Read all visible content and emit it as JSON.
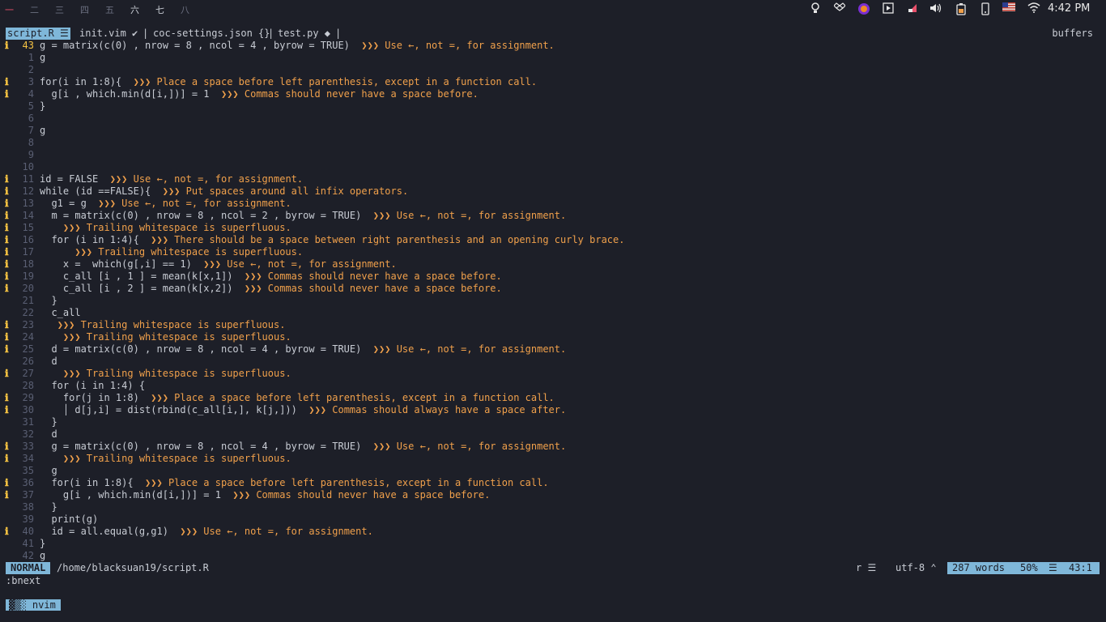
{
  "workspaces": [
    "一",
    "二",
    "三",
    "四",
    "五",
    "六",
    "七",
    "八"
  ],
  "clock": "4:42 PM",
  "tray_icons": [
    "bulb-icon",
    "dropbox-icon",
    "firefox-icon",
    "media-play-icon",
    "app-icon",
    "volume-icon",
    "battery-icon",
    "phone-icon",
    "us-flag-icon",
    "wifi-icon"
  ],
  "tabs": {
    "active": "script.R ☰",
    "others": [
      "init.vim ✔",
      "|",
      "coc-settings.json {}",
      "|",
      "test.py ◆",
      "|"
    ],
    "buffers_label": "buffers"
  },
  "lines": [
    {
      "sign": "ℹ",
      "num": "43",
      "cur": true,
      "code": "g = matrix(c(0) , nrow = 8 , ncol = 4 , byrow = TRUE)",
      "msg": "  ❯❯❯ Use ←, not =, for assignment."
    },
    {
      "sign": "",
      "num": "1",
      "code": "g",
      "msg": ""
    },
    {
      "sign": "",
      "num": "2",
      "code": "",
      "msg": ""
    },
    {
      "sign": "ℹ",
      "num": "3",
      "code": "for(i in 1:8){",
      "msg": "  ❯❯❯ Place a space before left parenthesis, except in a function call."
    },
    {
      "sign": "ℹ",
      "num": "4",
      "code": "  g[i , which.min(d[i,])] = 1",
      "msg": "  ❯❯❯ Commas should never have a space before."
    },
    {
      "sign": "",
      "num": "5",
      "code": "}",
      "msg": ""
    },
    {
      "sign": "",
      "num": "6",
      "code": "",
      "msg": ""
    },
    {
      "sign": "",
      "num": "7",
      "code": "g",
      "msg": ""
    },
    {
      "sign": "",
      "num": "8",
      "code": "",
      "msg": ""
    },
    {
      "sign": "",
      "num": "9",
      "code": "",
      "msg": ""
    },
    {
      "sign": "",
      "num": "10",
      "code": "",
      "msg": ""
    },
    {
      "sign": "ℹ",
      "num": "11",
      "code": "id = FALSE",
      "msg": "  ❯❯❯ Use ←, not =, for assignment."
    },
    {
      "sign": "ℹ",
      "num": "12",
      "code": "while (id ==FALSE){",
      "msg": "  ❯❯❯ Put spaces around all infix operators."
    },
    {
      "sign": "ℹ",
      "num": "13",
      "code": "  g1 = g",
      "msg": "  ❯❯❯ Use ←, not =, for assignment."
    },
    {
      "sign": "ℹ",
      "num": "14",
      "code": "  m = matrix(c(0) , nrow = 8 , ncol = 2 , byrow = TRUE)",
      "msg": "  ❯❯❯ Use ←, not =, for assignment."
    },
    {
      "sign": "ℹ",
      "num": "15",
      "code": "   ",
      "msg": " ❯❯❯ Trailing whitespace is superfluous."
    },
    {
      "sign": "ℹ",
      "num": "16",
      "code": "  for (i in 1:4){",
      "msg": "  ❯❯❯ There should be a space between right parenthesis and an opening curly brace."
    },
    {
      "sign": "ℹ",
      "num": "17",
      "code": "     ",
      "msg": " ❯❯❯ Trailing whitespace is superfluous."
    },
    {
      "sign": "ℹ",
      "num": "18",
      "code": "    x =  which(g[,i] == 1)",
      "msg": "  ❯❯❯ Use ←, not =, for assignment."
    },
    {
      "sign": "ℹ",
      "num": "19",
      "code": "    c_all [i , 1 ] = mean(k[x,1])",
      "msg": "  ❯❯❯ Commas should never have a space before."
    },
    {
      "sign": "ℹ",
      "num": "20",
      "code": "    c_all [i , 2 ] = mean(k[x,2])",
      "msg": "  ❯❯❯ Commas should never have a space before."
    },
    {
      "sign": "",
      "num": "21",
      "code": "  }",
      "msg": ""
    },
    {
      "sign": "",
      "num": "22",
      "code": "  c_all",
      "msg": ""
    },
    {
      "sign": "ℹ",
      "num": "23",
      "code": "   ",
      "msg": "❯❯❯ Trailing whitespace is superfluous."
    },
    {
      "sign": "ℹ",
      "num": "24",
      "code": "   ",
      "msg": " ❯❯❯ Trailing whitespace is superfluous."
    },
    {
      "sign": "ℹ",
      "num": "25",
      "code": "  d = matrix(c(0) , nrow = 8 , ncol = 4 , byrow = TRUE)",
      "msg": "  ❯❯❯ Use ←, not =, for assignment."
    },
    {
      "sign": "",
      "num": "26",
      "code": "  d",
      "msg": ""
    },
    {
      "sign": "ℹ",
      "num": "27",
      "code": "   ",
      "msg": " ❯❯❯ Trailing whitespace is superfluous."
    },
    {
      "sign": "",
      "num": "28",
      "code": "  for (i in 1:4) {",
      "msg": ""
    },
    {
      "sign": "ℹ",
      "num": "29",
      "code": "    for(j in 1:8)",
      "msg": "  ❯❯❯ Place a space before left parenthesis, except in a function call."
    },
    {
      "sign": "ℹ",
      "num": "30",
      "code": "    │ d[j,i] = dist(rbind(c_all[i,], k[j,]))",
      "msg": "  ❯❯❯ Commas should always have a space after."
    },
    {
      "sign": "",
      "num": "31",
      "code": "  }",
      "msg": ""
    },
    {
      "sign": "",
      "num": "32",
      "code": "  d",
      "msg": ""
    },
    {
      "sign": "ℹ",
      "num": "33",
      "code": "  g = matrix(c(0) , nrow = 8 , ncol = 4 , byrow = TRUE)",
      "msg": "  ❯❯❯ Use ←, not =, for assignment."
    },
    {
      "sign": "ℹ",
      "num": "34",
      "code": "   ",
      "msg": " ❯❯❯ Trailing whitespace is superfluous."
    },
    {
      "sign": "",
      "num": "35",
      "code": "  g",
      "msg": ""
    },
    {
      "sign": "ℹ",
      "num": "36",
      "code": "  for(i in 1:8){",
      "msg": "  ❯❯❯ Place a space before left parenthesis, except in a function call."
    },
    {
      "sign": "ℹ",
      "num": "37",
      "code": "    g[i , which.min(d[i,])] = 1",
      "msg": "  ❯❯❯ Commas should never have a space before."
    },
    {
      "sign": "",
      "num": "38",
      "code": "  }",
      "msg": ""
    },
    {
      "sign": "",
      "num": "39",
      "code": "  print(g)",
      "msg": ""
    },
    {
      "sign": "ℹ",
      "num": "40",
      "code": "  id = all.equal(g,g1)",
      "msg": "  ❯❯❯ Use ←, not =, for assignment."
    },
    {
      "sign": "",
      "num": "41",
      "code": "}",
      "msg": ""
    },
    {
      "sign": "",
      "num": "42",
      "code": "g",
      "msg": ""
    }
  ],
  "statusline": {
    "mode": "NORMAL",
    "path": "/home/blacksuan19/script.R",
    "filetype": "r ☰",
    "encoding": "utf-8 ⌃",
    "words": "287 words",
    "percent": "50%",
    "lines_icon": "☰",
    "position": "43:1"
  },
  "cmdline": ":bnext",
  "tmux": "▓▒░ nvim",
  "colors": {
    "accent": "#7fb7d9",
    "warning": "#f0a04b",
    "sign": "#f5c242",
    "background": "#1d1f28"
  }
}
